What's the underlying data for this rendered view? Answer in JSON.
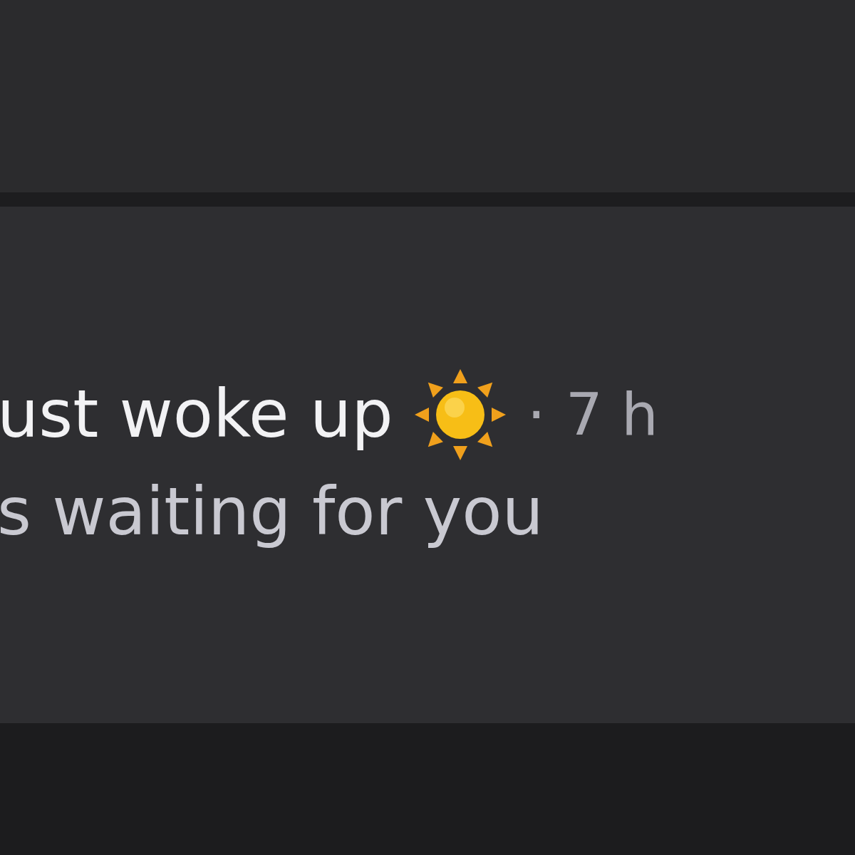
{
  "post": {
    "title": "ust woke up",
    "separator": "·",
    "time": "7 h",
    "subtitle": "s waiting for you"
  }
}
